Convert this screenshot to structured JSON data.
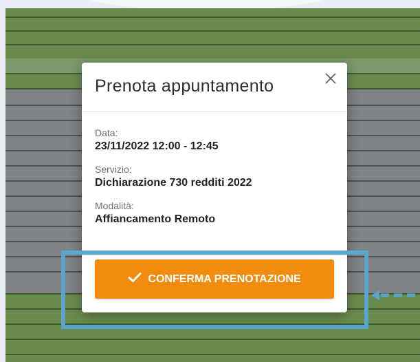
{
  "modal": {
    "title": "Prenota appuntamento",
    "close_icon": "close-icon",
    "fields": [
      {
        "label": "Data:",
        "value": "23/11/2022 12:00 - 12:45"
      },
      {
        "label": "Servizio:",
        "value": "Dichiarazione 730 redditi 2022"
      },
      {
        "label": "Modalità:",
        "value": "Affiancamento Remoto"
      }
    ],
    "confirm_button": {
      "label": "CONFERMA PRENOTAZIONE",
      "icon": "checkmark-icon",
      "color": "#f28c0f"
    }
  },
  "colors": {
    "highlight": "#5aa6cf",
    "calendar_green": "#6a8b4e",
    "calendar_gray": "#7f8385"
  }
}
